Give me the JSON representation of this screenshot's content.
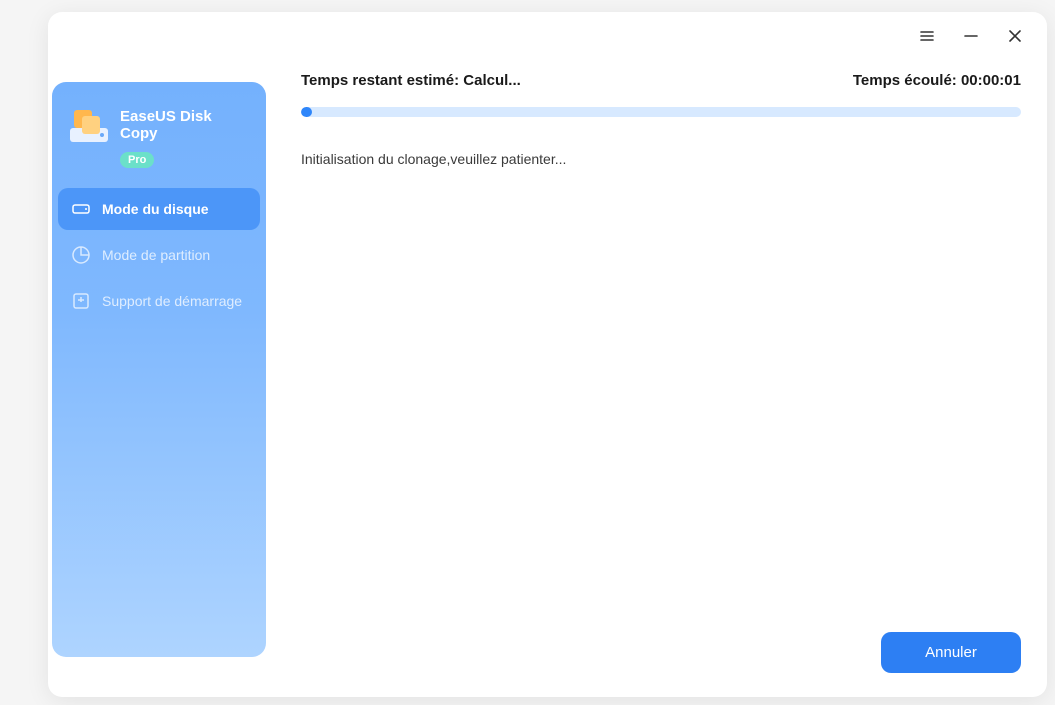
{
  "app": {
    "name": "EaseUS Disk Copy",
    "badge": "Pro"
  },
  "sidebar": {
    "items": [
      {
        "label": "Mode du disque"
      },
      {
        "label": "Mode de partition"
      },
      {
        "label": "Support de démarrage"
      }
    ]
  },
  "status": {
    "remaining_label": "Temps restant estimé: Calcul...",
    "elapsed_label": "Temps écoulé: 00:00:01",
    "message": "Initialisation du clonage,veuillez patienter..."
  },
  "actions": {
    "cancel": "Annuler"
  }
}
